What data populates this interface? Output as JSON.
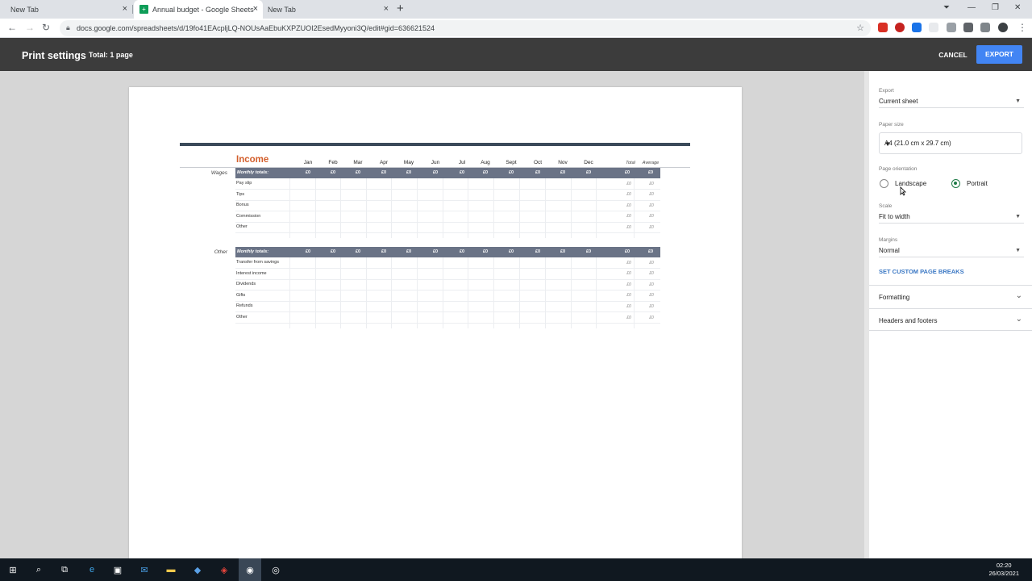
{
  "browser": {
    "tabs": [
      {
        "title": "New Tab",
        "active": false
      },
      {
        "title": "Annual budget - Google Sheets",
        "active": true
      },
      {
        "title": "New Tab",
        "active": false
      }
    ],
    "url": "docs.google.com/spreadsheets/d/19fo41EAcpljLQ-NOUsAaEbuKXPZUOI2EsedMyyoni3Q/edit#gid=636621524"
  },
  "header": {
    "title": "Print settings",
    "total": "Total: 1 page",
    "cancel_label": "CANCEL",
    "export_label": "EXPORT",
    "export_color": "#4285f4"
  },
  "sheet": {
    "title": "Income",
    "months": [
      "Jan",
      "Feb",
      "Mar",
      "Apr",
      "May",
      "Jun",
      "Jul",
      "Aug",
      "Sept",
      "Oct",
      "Nov",
      "Dec"
    ],
    "total_label": "Total",
    "average_label": "Average",
    "monthly_totals_label": "Monthly totals:",
    "zero": "£0",
    "sections": [
      {
        "name": "Wages",
        "rows": [
          "Pay slip",
          "Tips",
          "Bonus",
          "Commission",
          "Other"
        ]
      },
      {
        "name": "Other",
        "rows": [
          "Transfer from savings",
          "Interest income",
          "Dividends",
          "Gifts",
          "Refunds",
          "Other"
        ]
      }
    ]
  },
  "panel": {
    "export_label": "Export",
    "export_value": "Current sheet",
    "paper_label": "Paper size",
    "paper_value": "A4 (21.0 cm x 29.7 cm)",
    "orientation_label": "Page orientation",
    "landscape": "Landscape",
    "portrait": "Portrait",
    "orientation_selected": "Portrait",
    "scale_label": "Scale",
    "scale_value": "Fit to width",
    "margins_label": "Margins",
    "margins_value": "Normal",
    "page_breaks": "SET CUSTOM PAGE BREAKS",
    "formatting": "Formatting",
    "headers_footers": "Headers and footers"
  },
  "taskbar": {
    "time": "02:20",
    "date": "26/03/2021"
  }
}
